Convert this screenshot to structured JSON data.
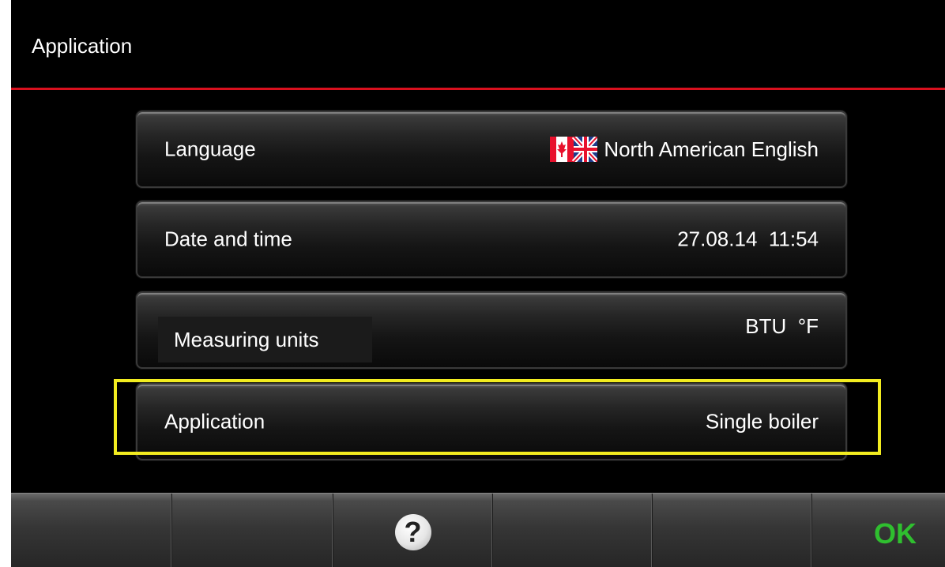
{
  "header": {
    "title": "Application"
  },
  "rows": [
    {
      "label": "Language",
      "value": "North American English",
      "flag": "canada-uk-flag-icon"
    },
    {
      "label": "Date and time",
      "value": "27.08.14  11:54"
    },
    {
      "label": "Measuring units",
      "value": "BTU  °F"
    },
    {
      "label": "Application",
      "value": "Single boiler"
    }
  ],
  "toolbar": {
    "help_label": "?",
    "ok_label": "OK"
  },
  "colors": {
    "accent_line": "#d9101e",
    "highlight": "#f2ec20",
    "ok": "#2fbf2f"
  }
}
